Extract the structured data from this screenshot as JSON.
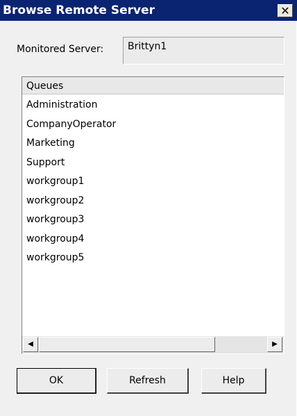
{
  "window": {
    "title": "Browse Remote Server",
    "close_glyph": "✕"
  },
  "monitored_server": {
    "label": "Monitored Server:",
    "value": "Brittyn1"
  },
  "queues": {
    "header": "Queues",
    "items": [
      "Administration",
      "CompanyOperator",
      "Marketing",
      "Support",
      "workgroup1",
      "workgroup2",
      "workgroup3",
      "workgroup4",
      "workgroup5"
    ]
  },
  "scrollbar": {
    "left_arrow": "◀",
    "right_arrow": "▶"
  },
  "buttons": {
    "ok": "OK",
    "refresh": "Refresh",
    "help": "Help"
  },
  "colors": {
    "titlebar": "#0a2472",
    "dialog_bg": "#f0f0f0"
  }
}
